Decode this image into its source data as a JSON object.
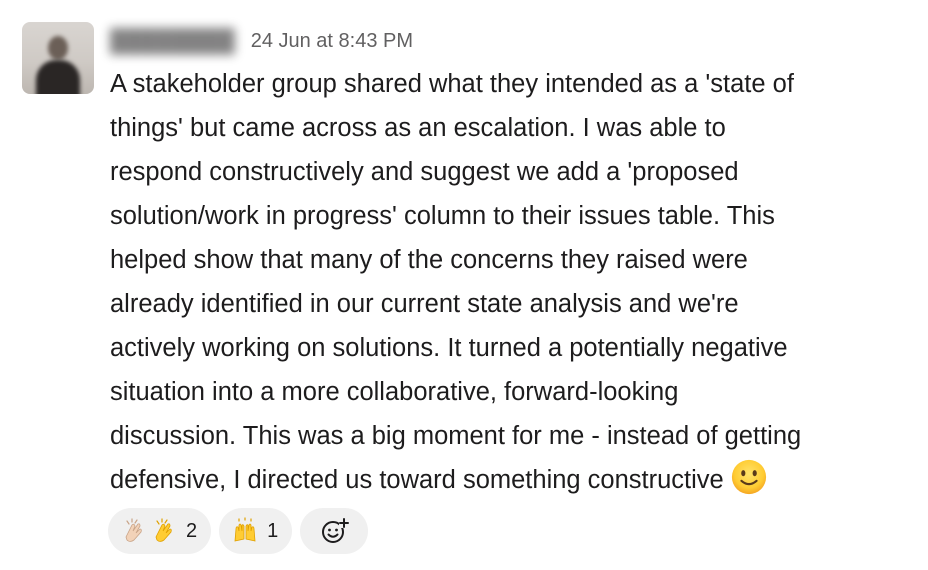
{
  "message": {
    "timestamp": "24 Jun at 8:43 PM",
    "lines": [
      "A stakeholder group shared what they intended as a 'state of",
      "things' but came across as an escalation. I was able to",
      "respond constructively and suggest we add a 'proposed",
      "solution/work in progress' column to their issues table. This",
      "helped show that many of the concerns they raised were",
      "already identified in our current state analysis and we're",
      "actively working on solutions. It turned a potentially negative",
      "situation into a more collaborative, forward-looking",
      "discussion. This was a big moment for me - instead of getting",
      "defensive, I directed us toward something constructive"
    ],
    "trailing_emoji": "slightly-smiling-face-icon"
  },
  "reactions": [
    {
      "emojis": [
        "clapping-hands-light-skin-icon",
        "clapping-hands-icon"
      ],
      "count": "2"
    },
    {
      "emojis": [
        "raising-hands-icon"
      ],
      "count": "1"
    }
  ],
  "add_reaction": {
    "icon": "add-reaction-icon"
  },
  "colors": {
    "text": "#1d1c1d",
    "timestamp": "#616061",
    "reaction_bg": "#f0f0f0"
  }
}
